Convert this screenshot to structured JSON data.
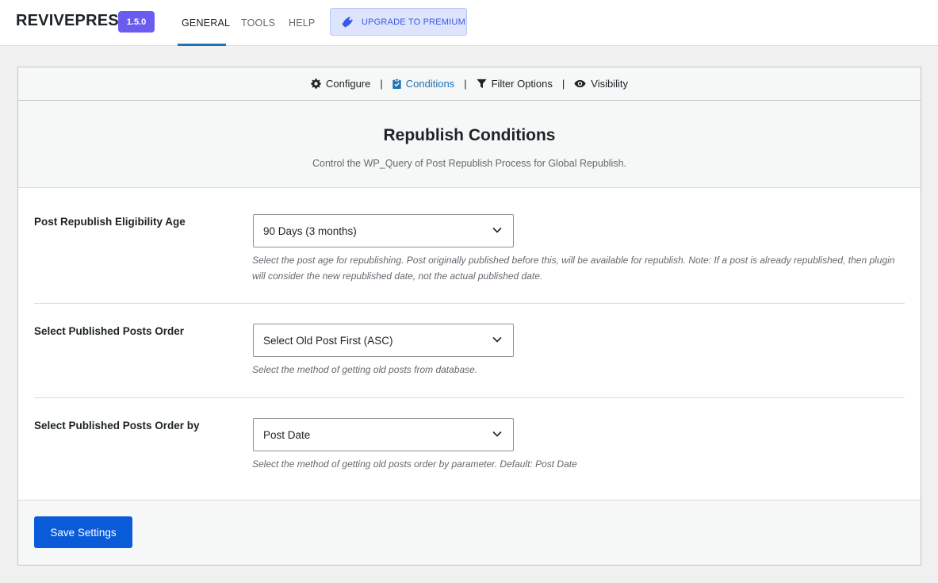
{
  "app": {
    "brand": "REVIVEPRESS",
    "version": "1.5.0"
  },
  "nav": {
    "tabs": [
      {
        "label": "GENERAL",
        "active": true
      },
      {
        "label": "TOOLS",
        "active": false
      },
      {
        "label": "HELP",
        "active": false
      }
    ],
    "upgrade_label": "UPGRADE TO PREMIUM"
  },
  "subnav": {
    "items": [
      {
        "label": "Configure",
        "icon": "gear-icon"
      },
      {
        "label": "Conditions",
        "icon": "clipboard-check-icon",
        "active": true
      },
      {
        "label": "Filter Options",
        "icon": "filter-icon"
      },
      {
        "label": "Visibility",
        "icon": "eye-icon"
      }
    ],
    "separator": "|"
  },
  "header": {
    "title": "Republish Conditions",
    "subtitle": "Control the WP_Query of Post Republish Process for Global Republish."
  },
  "settings": [
    {
      "label": "Post Republish Eligibility Age",
      "value": "90 Days (3 months)",
      "description": "Select the post age for republishing. Post originally published before this, will be available for republish. Note: If a post is already republished, then plugin will consider the new republished date, not the actual published date."
    },
    {
      "label": "Select Published Posts Order",
      "value": "Select Old Post First (ASC)",
      "description": "Select the method of getting old posts from database."
    },
    {
      "label": "Select Published Posts Order by",
      "value": "Post Date",
      "description": "Select the method of getting old posts order by parameter. Default: Post Date"
    }
  ],
  "footer": {
    "save_label": "Save Settings"
  },
  "colors": {
    "accent": "#2271b1",
    "version_badge": "#6b5cf0",
    "save_button": "#0a5bd9",
    "upgrade_bg": "#dde4fb"
  }
}
